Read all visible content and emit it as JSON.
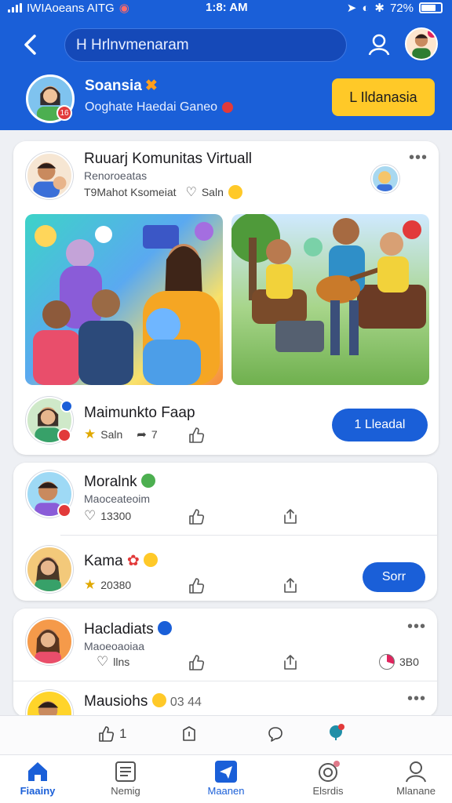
{
  "status_bar": {
    "carrier": "IWIAoeans AITG",
    "time": "1:8: AM",
    "battery": "72%"
  },
  "header": {
    "search_placeholder": "H Hrlnvmenaram",
    "profile_name": "Soansia",
    "profile_emoji": "✖",
    "profile_sub": "Ooghate Haedai Ganeo",
    "profile_badge": "16",
    "join_label": "L Ildanasia"
  },
  "post": {
    "title": "Ruuarj Komunitas Virtuall",
    "subtitle": "Renoroeatas",
    "meta": "T9Mahot Ksomeiat",
    "meta_like": "Saln",
    "group_name": "Maimunkto Faap",
    "group_meta_star": "Saln",
    "group_meta_count": "7",
    "join_label": "1 Lleadal"
  },
  "list": [
    {
      "name": "Moralnk",
      "sub": "Maoceateoim",
      "count": "13300",
      "badge": ""
    },
    {
      "name": "Kama",
      "sub": "",
      "count": "20380",
      "badge": "",
      "button": "Sorr"
    },
    {
      "name": "Hacladiats",
      "sub": "Maoeoaoiaa",
      "count": "llns",
      "extra": "3B0"
    },
    {
      "name": "Mausiohs",
      "sub": "",
      "count": "03 44"
    }
  ],
  "action_bar": {
    "like_count": "1"
  },
  "tabs": [
    {
      "label": "Fiaainy",
      "icon": "home-icon"
    },
    {
      "label": "Nemig",
      "icon": "list-icon"
    },
    {
      "label": "Maanen",
      "icon": "send-icon"
    },
    {
      "label": "Elsrdis",
      "icon": "camera-icon"
    },
    {
      "label": "Mlanane",
      "icon": "person-icon"
    }
  ],
  "colors": {
    "primary": "#1a5fd8",
    "accent": "#ffc928",
    "alert": "#e23a3a"
  }
}
